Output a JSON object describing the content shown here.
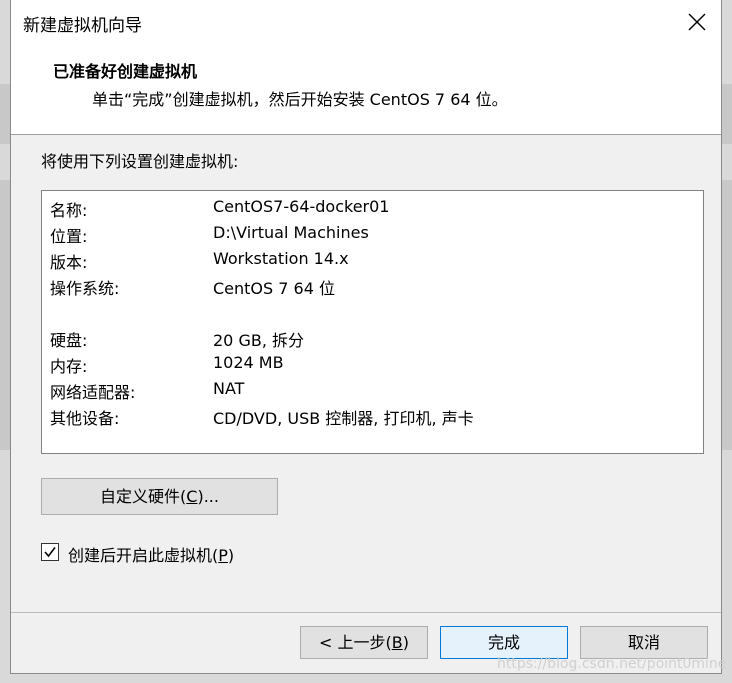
{
  "window": {
    "title": "新建虚拟机向导"
  },
  "header": {
    "title": "已准备好创建虚拟机",
    "subtitle": "单击“完成”创建虚拟机，然后开始安装 CentOS 7 64 位。"
  },
  "main": {
    "section_label": "将使用下列设置创建虚拟机:",
    "summary": [
      {
        "key": "名称:",
        "value": "CentOS7-64-docker01"
      },
      {
        "key": "位置:",
        "value": "D:\\Virtual Machines"
      },
      {
        "key": "版本:",
        "value": "Workstation 14.x"
      },
      {
        "key": "操作系统:",
        "value": "CentOS 7 64 位"
      },
      {
        "key": "硬盘:",
        "value": "20 GB, 拆分"
      },
      {
        "key": "内存:",
        "value": "1024 MB"
      },
      {
        "key": "网络适配器:",
        "value": "NAT"
      },
      {
        "key": "其他设备:",
        "value": "CD/DVD, USB 控制器, 打印机, 声卡"
      }
    ],
    "customize_button": {
      "prefix": "自定义硬件(",
      "mnemonic": "C",
      "suffix": ")..."
    },
    "power_on_checkbox": {
      "prefix": "创建后开启此虚拟机(",
      "mnemonic": "P",
      "suffix": ")",
      "checked": true
    }
  },
  "footer": {
    "back_button": {
      "prefix": "< 上一步(",
      "mnemonic": "B",
      "suffix": ")"
    },
    "finish_button": "完成",
    "cancel_button": "取消"
  },
  "watermark": "https://blog.csdn.net/point0mine",
  "icons": {
    "close": "close-icon",
    "check": "checkmark-icon"
  },
  "colors": {
    "dialog_bg": "#f0f0f0",
    "header_bg": "#ffffff",
    "default_button_border": "#0078d7"
  }
}
